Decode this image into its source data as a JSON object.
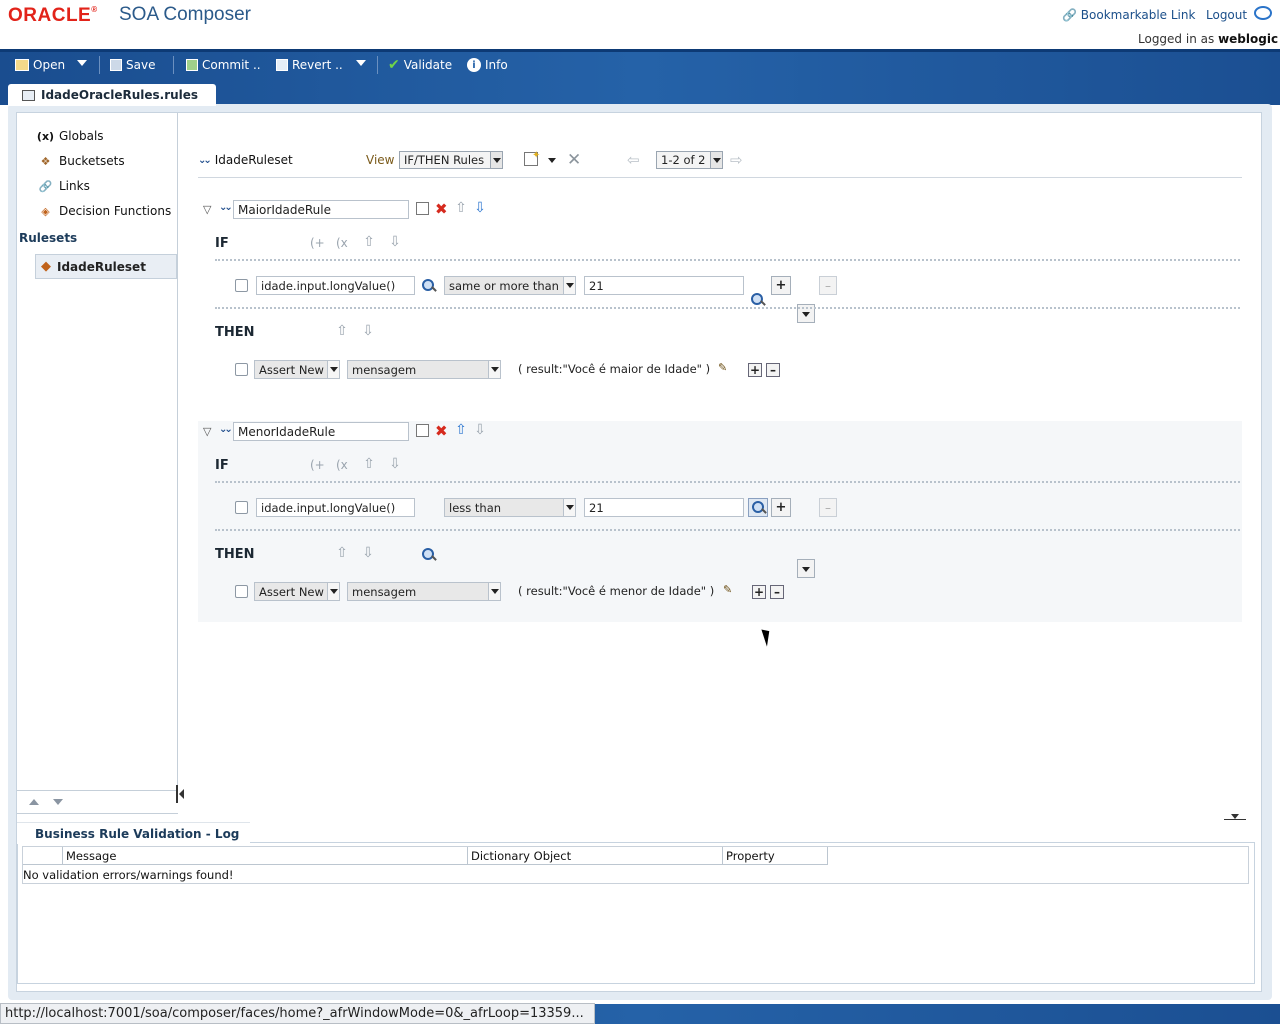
{
  "header": {
    "logo_text": "ORACLE",
    "app_title": "SOA Composer",
    "bookmarkable_link": "Bookmarkable Link",
    "logout": "Logout",
    "logged_in_prefix": "Logged in as",
    "user": "weblogic"
  },
  "toolbar": {
    "open": "Open",
    "save": "Save",
    "commit": "Commit ..",
    "revert": "Revert ..",
    "validate": "Validate",
    "info": "Info"
  },
  "file_tab": "IdadeOracleRules.rules",
  "sidebar": {
    "items": [
      {
        "label": "Globals",
        "icon": "variable-icon",
        "glyph": "(x)"
      },
      {
        "label": "Bucketsets",
        "icon": "bucketset-icon",
        "glyph": "❖"
      },
      {
        "label": "Links",
        "icon": "link-icon",
        "glyph": "🔗"
      },
      {
        "label": "Decision Functions",
        "icon": "decision-function-icon",
        "glyph": "◈"
      }
    ],
    "rulesets_label": "Rulesets",
    "selected_ruleset": "IdadeRuleset"
  },
  "ruleset_header": {
    "name": "IdadeRuleset",
    "view_label": "View",
    "view_value": "IF/THEN Rules",
    "pager_value": "1-2 of 2"
  },
  "rules": [
    {
      "name": "MaiorIdadeRule",
      "if_label": "IF",
      "then_label": "THEN",
      "condition": {
        "left": "idade.input.longValue()",
        "operator": "same or more than",
        "right": "21"
      },
      "action": {
        "type": "Assert New",
        "target": "mensagem",
        "result": "( result:\"Você é maior de Idade\" )"
      }
    },
    {
      "name": "MenorIdadeRule",
      "if_label": "IF",
      "then_label": "THEN",
      "condition": {
        "left": "idade.input.longValue()",
        "operator": "less than",
        "right": "21"
      },
      "action": {
        "type": "Assert New",
        "target": "mensagem",
        "result": "( result:\"Você é menor de Idade\" )"
      }
    }
  ],
  "log": {
    "tab_title": "Business Rule Validation - Log",
    "columns": [
      "Message",
      "Dictionary Object",
      "Property"
    ],
    "message": "No validation errors/warnings found!"
  },
  "status_url": "http://localhost:7001/soa/composer/faces/home?_afrWindowMode=0&_afrLoop=13359...",
  "colors": {
    "brand_red": "#e2231a",
    "toolbar_blue": "#2562a8",
    "link_blue": "#1b4f8a"
  }
}
